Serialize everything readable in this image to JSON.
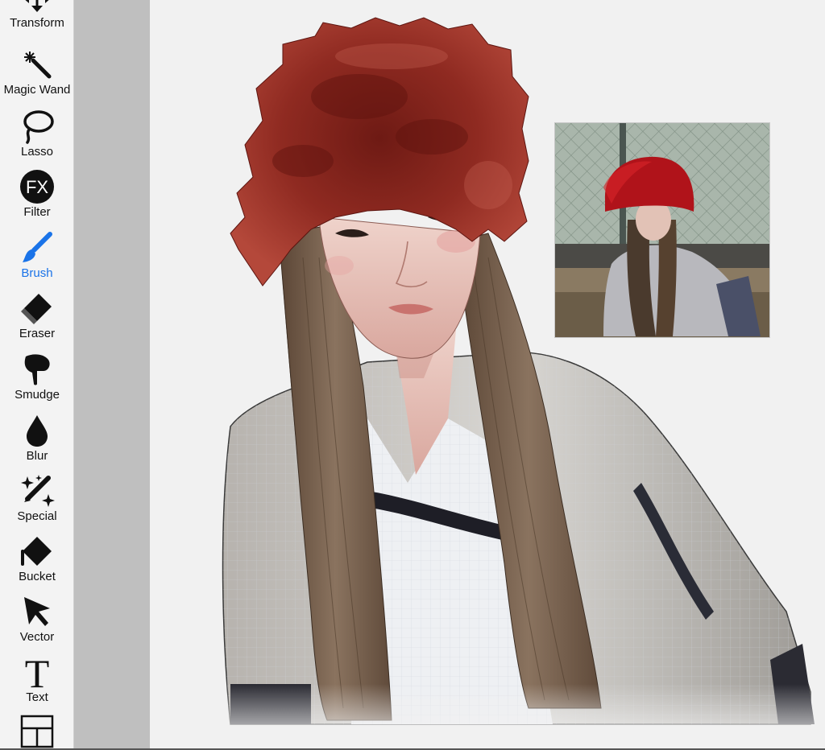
{
  "toolbar": {
    "tools": [
      {
        "label": "Transform",
        "icon": "move-arrows-icon"
      },
      {
        "label": "Magic Wand",
        "icon": "magic-wand-icon"
      },
      {
        "label": "Lasso",
        "icon": "lasso-icon"
      },
      {
        "label": "Filter",
        "icon": "fx-icon",
        "glyph": "FX"
      },
      {
        "label": "Brush",
        "icon": "brush-icon",
        "active": true
      },
      {
        "label": "Eraser",
        "icon": "eraser-icon"
      },
      {
        "label": "Smudge",
        "icon": "smudge-hand-icon"
      },
      {
        "label": "Blur",
        "icon": "droplet-icon"
      },
      {
        "label": "Special",
        "icon": "sparkle-pen-icon"
      },
      {
        "label": "Bucket",
        "icon": "paint-bucket-icon"
      },
      {
        "label": "Vector",
        "icon": "cursor-arrow-icon"
      },
      {
        "label": "Text",
        "icon": "text-t-icon",
        "glyph": "T"
      },
      {
        "label": "",
        "icon": "layout-panels-icon"
      }
    ],
    "active_color": "#1a73e8"
  },
  "canvas": {
    "background": "#f1f1f1",
    "artwork": "digital painting of a person with long brown hair wearing a red fur hat and a grey and white top",
    "reference_photo": "reference photo of a person in a red fur hat sitting in front of a chain-link fence",
    "colors": {
      "hat": "#9c2b22",
      "hair": "#7a6350",
      "jacket": "#c9c6c2",
      "skin": "#e9c4bb"
    }
  }
}
